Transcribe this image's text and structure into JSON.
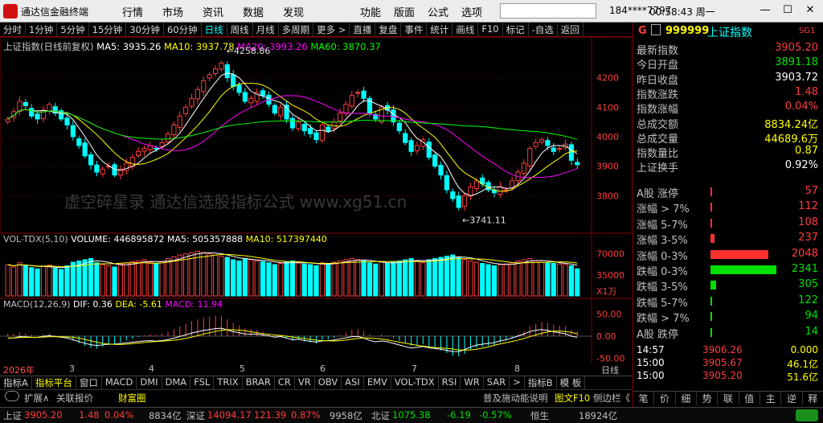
{
  "window": {
    "app_title": "通达信金融终端",
    "menu": [
      "行情",
      "市场",
      "资讯",
      "数据",
      "发现"
    ],
    "menu2": [
      "功能",
      "版面",
      "公式",
      "选项"
    ],
    "user": "184****7797",
    "clock": "00:58:43 周一"
  },
  "toolbar": {
    "items": [
      "分时",
      "1分钟",
      "5分钟",
      "15分钟",
      "30分钟",
      "60分钟",
      "日线",
      "周线",
      "月线",
      "多周期",
      "更多 >",
      "直播",
      "复盘",
      "事件",
      "统计",
      "画线",
      "F10",
      "标记",
      "-自选",
      "返回"
    ],
    "active": "日线"
  },
  "chart_header": {
    "name": "上证指数(日线前复权)",
    "ma5": "MA5: 3935.26",
    "ma10": "MA10: 3937.78",
    "ma20": "MA20: 3993.26",
    "ma60": "MA60: 3870.37"
  },
  "annotations": {
    "high": "4258.86",
    "low": "3741.11"
  },
  "price_axis": [
    "4200",
    "4100",
    "4000",
    "3900",
    "3800"
  ],
  "vol_header": {
    "name": "VOL-TDX(5,10)",
    "volume": "VOLUME: 446895872",
    "ma5": "MA5: 505357888",
    "ma10": "MA10: 517397440"
  },
  "vol_axis": [
    "70000",
    "35000",
    "X1万"
  ],
  "macd_header": {
    "name": "MACD(12,26,9)",
    "dif": "DIF: 0.36",
    "dea": "DEA: -5.61",
    "macd": "MACD: 11.94"
  },
  "macd_axis": [
    "50.00",
    "0.00",
    "-50.00"
  ],
  "xaxis": {
    "labels": [
      "2026年",
      "3",
      "4",
      "5",
      "6",
      "7",
      "8"
    ],
    "period": "日线"
  },
  "bottom_tabs": [
    "指标A",
    "指标平台",
    "窗口",
    "MACD",
    "DMI",
    "DMA",
    "FSL",
    "TRIX",
    "BRAR",
    "CR",
    "VR",
    "OBV",
    "ASI",
    "EMV",
    "VOL-TDX",
    "RSI",
    "WR",
    "SAR",
    ">",
    "指标B",
    "模 板"
  ],
  "bottom_tabs_active": "指标平台",
  "bottom_row2": {
    "left": [
      "扩展∧",
      "关联报价",
      "财富圈"
    ],
    "right": [
      "普及施动能说明",
      "图文F10",
      "侧边栏《"
    ]
  },
  "stock": {
    "code_prefix": "G",
    "code": "999999",
    "name": "上证指数",
    "badge": "SG1"
  },
  "quote": [
    {
      "label": "最新指数",
      "value": "3905.20",
      "cls": "red"
    },
    {
      "label": "今日开盘",
      "value": "3891.18",
      "cls": "grn"
    },
    {
      "label": "昨日收盘",
      "value": "3903.72",
      "cls": "wht"
    },
    {
      "label": "指数涨跌",
      "value": "1.48",
      "cls": "red"
    },
    {
      "label": "指数涨幅",
      "value": "0.04%",
      "cls": "red"
    },
    {
      "label": "总成交额",
      "value": "8834.24亿",
      "cls": "yel"
    },
    {
      "label": "总成交量",
      "value": "44689.6万",
      "cls": "yel"
    },
    {
      "label": "指数量比",
      "value": "0.87",
      "cls": "yel"
    },
    {
      "label": "上证换手",
      "value": "0.92%",
      "cls": "wht"
    }
  ],
  "breadth": [
    {
      "label": "A股 涨停",
      "value": "57",
      "cls": "red",
      "bar": 0
    },
    {
      "label": "涨幅 > 7%",
      "value": "112",
      "cls": "red",
      "bar": 0.02
    },
    {
      "label": "涨幅 5-7%",
      "value": "108",
      "cls": "red",
      "bar": 0.02
    },
    {
      "label": "涨幅 3-5%",
      "value": "237",
      "cls": "red",
      "bar": 0.06
    },
    {
      "label": "涨幅 0-3%",
      "value": "2048",
      "cls": "red",
      "bar": 0.88
    },
    {
      "label": "跌幅 0-3%",
      "value": "2341",
      "cls": "grn",
      "bar": 1.0
    },
    {
      "label": "跌幅 3-5%",
      "value": "305",
      "cls": "grn",
      "bar": 0.09
    },
    {
      "label": "跌幅 5-7%",
      "value": "122",
      "cls": "grn",
      "bar": 0.03
    },
    {
      "label": "跌幅 > 7%",
      "value": "94",
      "cls": "grn",
      "bar": 0.015
    },
    {
      "label": "A股 跌停",
      "value": "14",
      "cls": "grn",
      "bar": 0.005
    }
  ],
  "ticks": [
    {
      "time": "14:57",
      "price": "3906.26",
      "vol": "0.000"
    },
    {
      "time": "15:00",
      "price": "3905.67",
      "vol": "46.1亿"
    },
    {
      "time": "15:00",
      "price": "3905.20",
      "vol": "51.6亿"
    }
  ],
  "right_tabs": [
    "笔",
    "价",
    "细",
    "势",
    "联",
    "值",
    "主",
    "逆",
    "释"
  ],
  "statusbar": {
    "sh_label": "上证",
    "sh_price": "3905.20",
    "sh_chg": "1.48",
    "sh_pct": "0.04%",
    "sh_amt": "8834亿",
    "sz_label": "深证",
    "sz_price": "14094.17",
    "sz_chg": "121.39",
    "sz_pct": "0.87%",
    "sz_amt": "9958亿",
    "bz_label": "北证",
    "bz_price": "1075.38",
    "bz_chg": "-6.19",
    "bz_pct": "-0.57%",
    "bz_amt": "",
    "hs_label": "恒生",
    "hs_amt": "18924亿"
  },
  "watermark": "虚空碎星录 通达信选股指标公式 www.xg51.cn",
  "chart_data": {
    "type": "candlestick",
    "ylim": [
      3700,
      4300
    ],
    "closes": [
      4060,
      4085,
      4120,
      4105,
      4070,
      4060,
      4090,
      4110,
      4080,
      4060,
      4040,
      4000,
      3970,
      3935,
      3905,
      3880,
      3890,
      3900,
      3870,
      3890,
      3910,
      3930,
      3950,
      3960,
      3970,
      3960,
      3980,
      4010,
      4040,
      4070,
      4100,
      4130,
      4160,
      4190,
      4210,
      4230,
      4250,
      4200,
      4170,
      4150,
      4120,
      4130,
      4150,
      4140,
      4110,
      4080,
      4100,
      4060,
      4030,
      4050,
      4020,
      4010,
      3990,
      4040,
      4020,
      4050,
      4080,
      4110,
      4140,
      4150,
      4130,
      4080,
      4060,
      4100,
      4090,
      4050,
      4020,
      3980,
      3950,
      3970,
      3990,
      3930,
      3900,
      3870,
      3820,
      3790,
      3760,
      3800,
      3830,
      3850,
      3840,
      3820,
      3810,
      3830,
      3820,
      3850,
      3880,
      3910,
      3960,
      3980,
      3990,
      3970,
      3950,
      3960,
      3975,
      3920,
      3905
    ],
    "volumes": [
      52,
      48,
      55,
      50,
      47,
      45,
      49,
      51,
      46,
      44,
      50,
      56,
      58,
      60,
      62,
      55,
      52,
      50,
      48,
      53,
      55,
      57,
      58,
      60,
      56,
      54,
      57,
      62,
      65,
      68,
      70,
      72,
      74,
      72,
      70,
      68,
      66,
      64,
      60,
      58,
      62,
      60,
      58,
      57,
      55,
      52,
      54,
      56,
      58,
      55,
      53,
      52,
      50,
      55,
      54,
      56,
      58,
      60,
      62,
      60,
      58,
      55,
      53,
      56,
      54,
      56,
      58,
      60,
      62,
      58,
      55,
      60,
      62,
      64,
      66,
      68,
      64,
      60,
      58,
      56,
      54,
      52,
      50,
      52,
      53,
      55,
      58,
      60,
      62,
      58,
      56,
      55,
      54,
      53,
      52,
      50,
      45
    ],
    "macd": [
      6,
      5,
      8,
      6,
      3,
      1,
      4,
      6,
      2,
      -1,
      -4,
      -10,
      -16,
      -22,
      -26,
      -28,
      -24,
      -20,
      -18,
      -14,
      -10,
      -6,
      -2,
      2,
      4,
      3,
      6,
      10,
      16,
      22,
      28,
      34,
      38,
      42,
      44,
      46,
      46,
      38,
      30,
      24,
      18,
      16,
      14,
      10,
      6,
      0,
      2,
      -4,
      -10,
      -8,
      -12,
      -14,
      -16,
      -10,
      -8,
      -4,
      2,
      8,
      14,
      16,
      12,
      4,
      0,
      4,
      2,
      -4,
      -10,
      -16,
      -22,
      -20,
      -18,
      -24,
      -28,
      -32,
      -38,
      -44,
      -46,
      -40,
      -32,
      -26,
      -24,
      -22,
      -20,
      -14,
      -10,
      -4,
      4,
      12,
      22,
      28,
      32,
      30,
      26,
      24,
      22,
      14,
      12
    ]
  }
}
